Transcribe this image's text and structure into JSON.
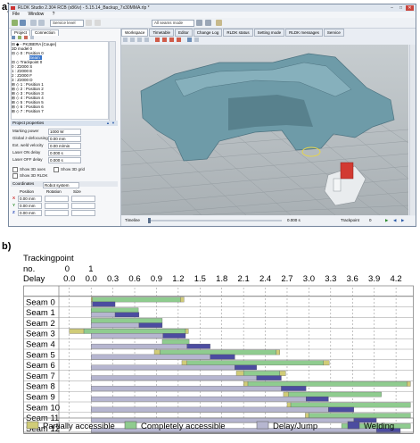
{
  "labels": {
    "a": "a)",
    "b": "b)"
  },
  "window": {
    "title": "RLDK Studio 2.304 RCB (x86/v) - 5.15.14_Backup_7x30MMA.rlp *",
    "min": "–",
    "max": "□",
    "close": "✕",
    "menu": [
      "File",
      "Window",
      "?"
    ],
    "toolbar_combo": "Service level",
    "toolbar_combo2": "All seams mode",
    "left_tabs": [
      "Project",
      "Connection"
    ],
    "tree": [
      "⊟ ◆ - PK2BERA [Coupe]",
      "   3D model 0",
      "  ⊟ ◇ 0 : Position 0",
      "      Seam",
      "    ⊟ ◇ Trackpoint 0",
      "       0 : Z2000 S",
      "       1 : Z2000 E",
      "       2 : Z2000 F",
      "       3 : Z2000 D",
      "  ⊞ ◇ 1 : Position 1",
      "  ⊞ ◇ 2 : Position 2",
      "  ⊞ ◇ 3 : Position 3",
      "  ⊞ ◇ 4 : Position 4",
      "  ⊞ ◇ 5 : Position 5",
      "  ⊞ ◇ 6 : Position 6",
      "  ⊞ ◇ 7 : Position 7"
    ],
    "project_properties": "Project properties",
    "props": [
      {
        "label": "Marking power",
        "value": "1000 W"
      },
      {
        "label": "Global z-defocusing",
        "value": "0.00 mm"
      },
      {
        "label": "Ext. weld velocity",
        "value": "0.00 m/min"
      },
      {
        "label": "Laser ON delay",
        "value": "0.000 s"
      },
      {
        "label": "Laser OFF delay",
        "value": "0.000 s"
      }
    ],
    "checks": [
      "Show 3D axes",
      "Show 3D grid",
      "Show 3D RLDK"
    ],
    "coordinates_label": "Coordinates",
    "coordinates_value": "Robot system",
    "coord_headers": [
      "Position",
      "Rotation",
      "Size"
    ],
    "coords": [
      {
        "axis": "X",
        "value": "0.00 mm"
      },
      {
        "axis": "Y",
        "value": "0.00 mm"
      },
      {
        "axis": "Z",
        "value": "0.00 mm"
      }
    ],
    "view_tabs": [
      "Workspace",
      "Timetable",
      "Editor",
      "Change Log",
      "RLDK status",
      "Setting mode",
      "RLDK messages",
      "Service"
    ],
    "timeline_label": "Timeline",
    "time_value": "0.000 s",
    "trackpoint_label": "Trackpoint",
    "trackpoint_value": "0"
  },
  "chart_data": {
    "type": "gantt",
    "header": {
      "row1": "Trackingpoint",
      "row2": "no.",
      "row3": "Delay",
      "tp_ticks": [
        "0",
        "1"
      ]
    },
    "x_ticks": [
      "0.0",
      "0.0",
      "0.3",
      "0.6",
      "0.9",
      "1.2",
      "1.5",
      "1.8",
      "2.1",
      "2.4",
      "2.7",
      "3.0",
      "3.3",
      "3.6",
      "3.9",
      "4.2"
    ],
    "x_tick_values": [
      -0.3,
      0.0,
      0.3,
      0.6,
      0.9,
      1.2,
      1.5,
      1.8,
      2.1,
      2.4,
      2.7,
      3.0,
      3.3,
      3.6,
      3.9,
      4.2
    ],
    "xlim": [
      -0.42,
      4.42
    ],
    "colors": {
      "partial": "#d0cc78",
      "complete": "#8fcc8f",
      "delay": "#b6b6d0",
      "welding": "#4c4ca0"
    },
    "legend": [
      {
        "key": "partial",
        "label": "Partially accessible"
      },
      {
        "key": "complete",
        "label": "Completely accessible"
      },
      {
        "key": "delay",
        "label": "Delay/Jump"
      },
      {
        "key": "welding",
        "label": "Welding"
      }
    ],
    "rows": [
      {
        "name": "Seam 0",
        "top": [
          [
            "partial",
            0.0,
            0.02
          ],
          [
            "complete",
            0.02,
            1.23
          ],
          [
            "partial",
            1.23,
            1.28
          ]
        ],
        "bottom": [
          [
            "delay",
            0.0,
            0.02
          ],
          [
            "welding",
            0.02,
            0.33
          ]
        ]
      },
      {
        "name": "Seam 1",
        "top": [
          [
            "complete",
            0.0,
            0.65
          ]
        ],
        "bottom": [
          [
            "delay",
            0.0,
            0.33
          ],
          [
            "welding",
            0.33,
            0.66
          ]
        ]
      },
      {
        "name": "Seam 2",
        "top": [
          [
            "complete",
            0.0,
            0.98
          ]
        ],
        "bottom": [
          [
            "delay",
            0.0,
            0.66
          ],
          [
            "welding",
            0.66,
            0.98
          ]
        ]
      },
      {
        "name": "Seam 3",
        "top": [
          [
            "partial",
            -0.3,
            -0.1
          ],
          [
            "complete",
            -0.1,
            1.3
          ],
          [
            "partial",
            1.3,
            1.34
          ]
        ],
        "bottom": [
          [
            "delay",
            0.0,
            0.99
          ],
          [
            "welding",
            0.99,
            1.3
          ]
        ]
      },
      {
        "name": "Seam 4",
        "top": [
          [
            "complete",
            0.98,
            1.35
          ]
        ],
        "bottom": [
          [
            "delay",
            0.0,
            1.32
          ],
          [
            "welding",
            1.32,
            1.64
          ]
        ]
      },
      {
        "name": "Seam 5",
        "top": [
          [
            "partial",
            0.87,
            0.95
          ],
          [
            "complete",
            0.95,
            2.55
          ],
          [
            "partial",
            2.55,
            2.6
          ]
        ],
        "bottom": [
          [
            "delay",
            0.0,
            1.64
          ],
          [
            "welding",
            1.64,
            1.98
          ]
        ]
      },
      {
        "name": "Seam 6",
        "top": [
          [
            "partial",
            1.25,
            1.32
          ],
          [
            "complete",
            1.32,
            3.2
          ],
          [
            "partial",
            3.2,
            3.28
          ]
        ],
        "bottom": [
          [
            "delay",
            0.0,
            1.98
          ],
          [
            "welding",
            1.98,
            2.28
          ]
        ]
      },
      {
        "name": "Seam 7",
        "top": [
          [
            "partial",
            2.0,
            2.1
          ],
          [
            "complete",
            2.1,
            2.6
          ],
          [
            "partial",
            2.6,
            2.68
          ]
        ],
        "bottom": [
          [
            "delay",
            0.0,
            2.28
          ],
          [
            "welding",
            2.28,
            2.62
          ]
        ]
      },
      {
        "name": "Seam 8",
        "top": [
          [
            "partial",
            2.1,
            2.16
          ],
          [
            "complete",
            2.16,
            4.35
          ],
          [
            "partial",
            4.35,
            4.4
          ]
        ],
        "bottom": [
          [
            "delay",
            0.0,
            2.62
          ],
          [
            "welding",
            2.62,
            2.96
          ]
        ]
      },
      {
        "name": "Seam 9",
        "top": [
          [
            "partial",
            2.65,
            2.72
          ],
          [
            "complete",
            2.72,
            4.0
          ]
        ],
        "bottom": [
          [
            "delay",
            0.0,
            2.96
          ],
          [
            "welding",
            2.96,
            3.27
          ]
        ]
      },
      {
        "name": "Seam 10",
        "top": [
          [
            "partial",
            2.7,
            2.75
          ],
          [
            "complete",
            2.75,
            4.4
          ]
        ],
        "bottom": [
          [
            "delay",
            0.0,
            3.27
          ],
          [
            "welding",
            3.27,
            3.62
          ]
        ]
      },
      {
        "name": "Seam 11",
        "top": [
          [
            "partial",
            2.95,
            3.0
          ],
          [
            "complete",
            3.0,
            4.4
          ]
        ],
        "bottom": [
          [
            "delay",
            0.0,
            3.62
          ],
          [
            "welding",
            3.62,
            3.93
          ]
        ]
      },
      {
        "name": "Seam 12",
        "top": [
          [
            "complete",
            3.45,
            4.4
          ]
        ],
        "bottom": [
          [
            "delay",
            0.0,
            3.93
          ],
          [
            "welding",
            3.93,
            4.26
          ]
        ]
      }
    ]
  }
}
